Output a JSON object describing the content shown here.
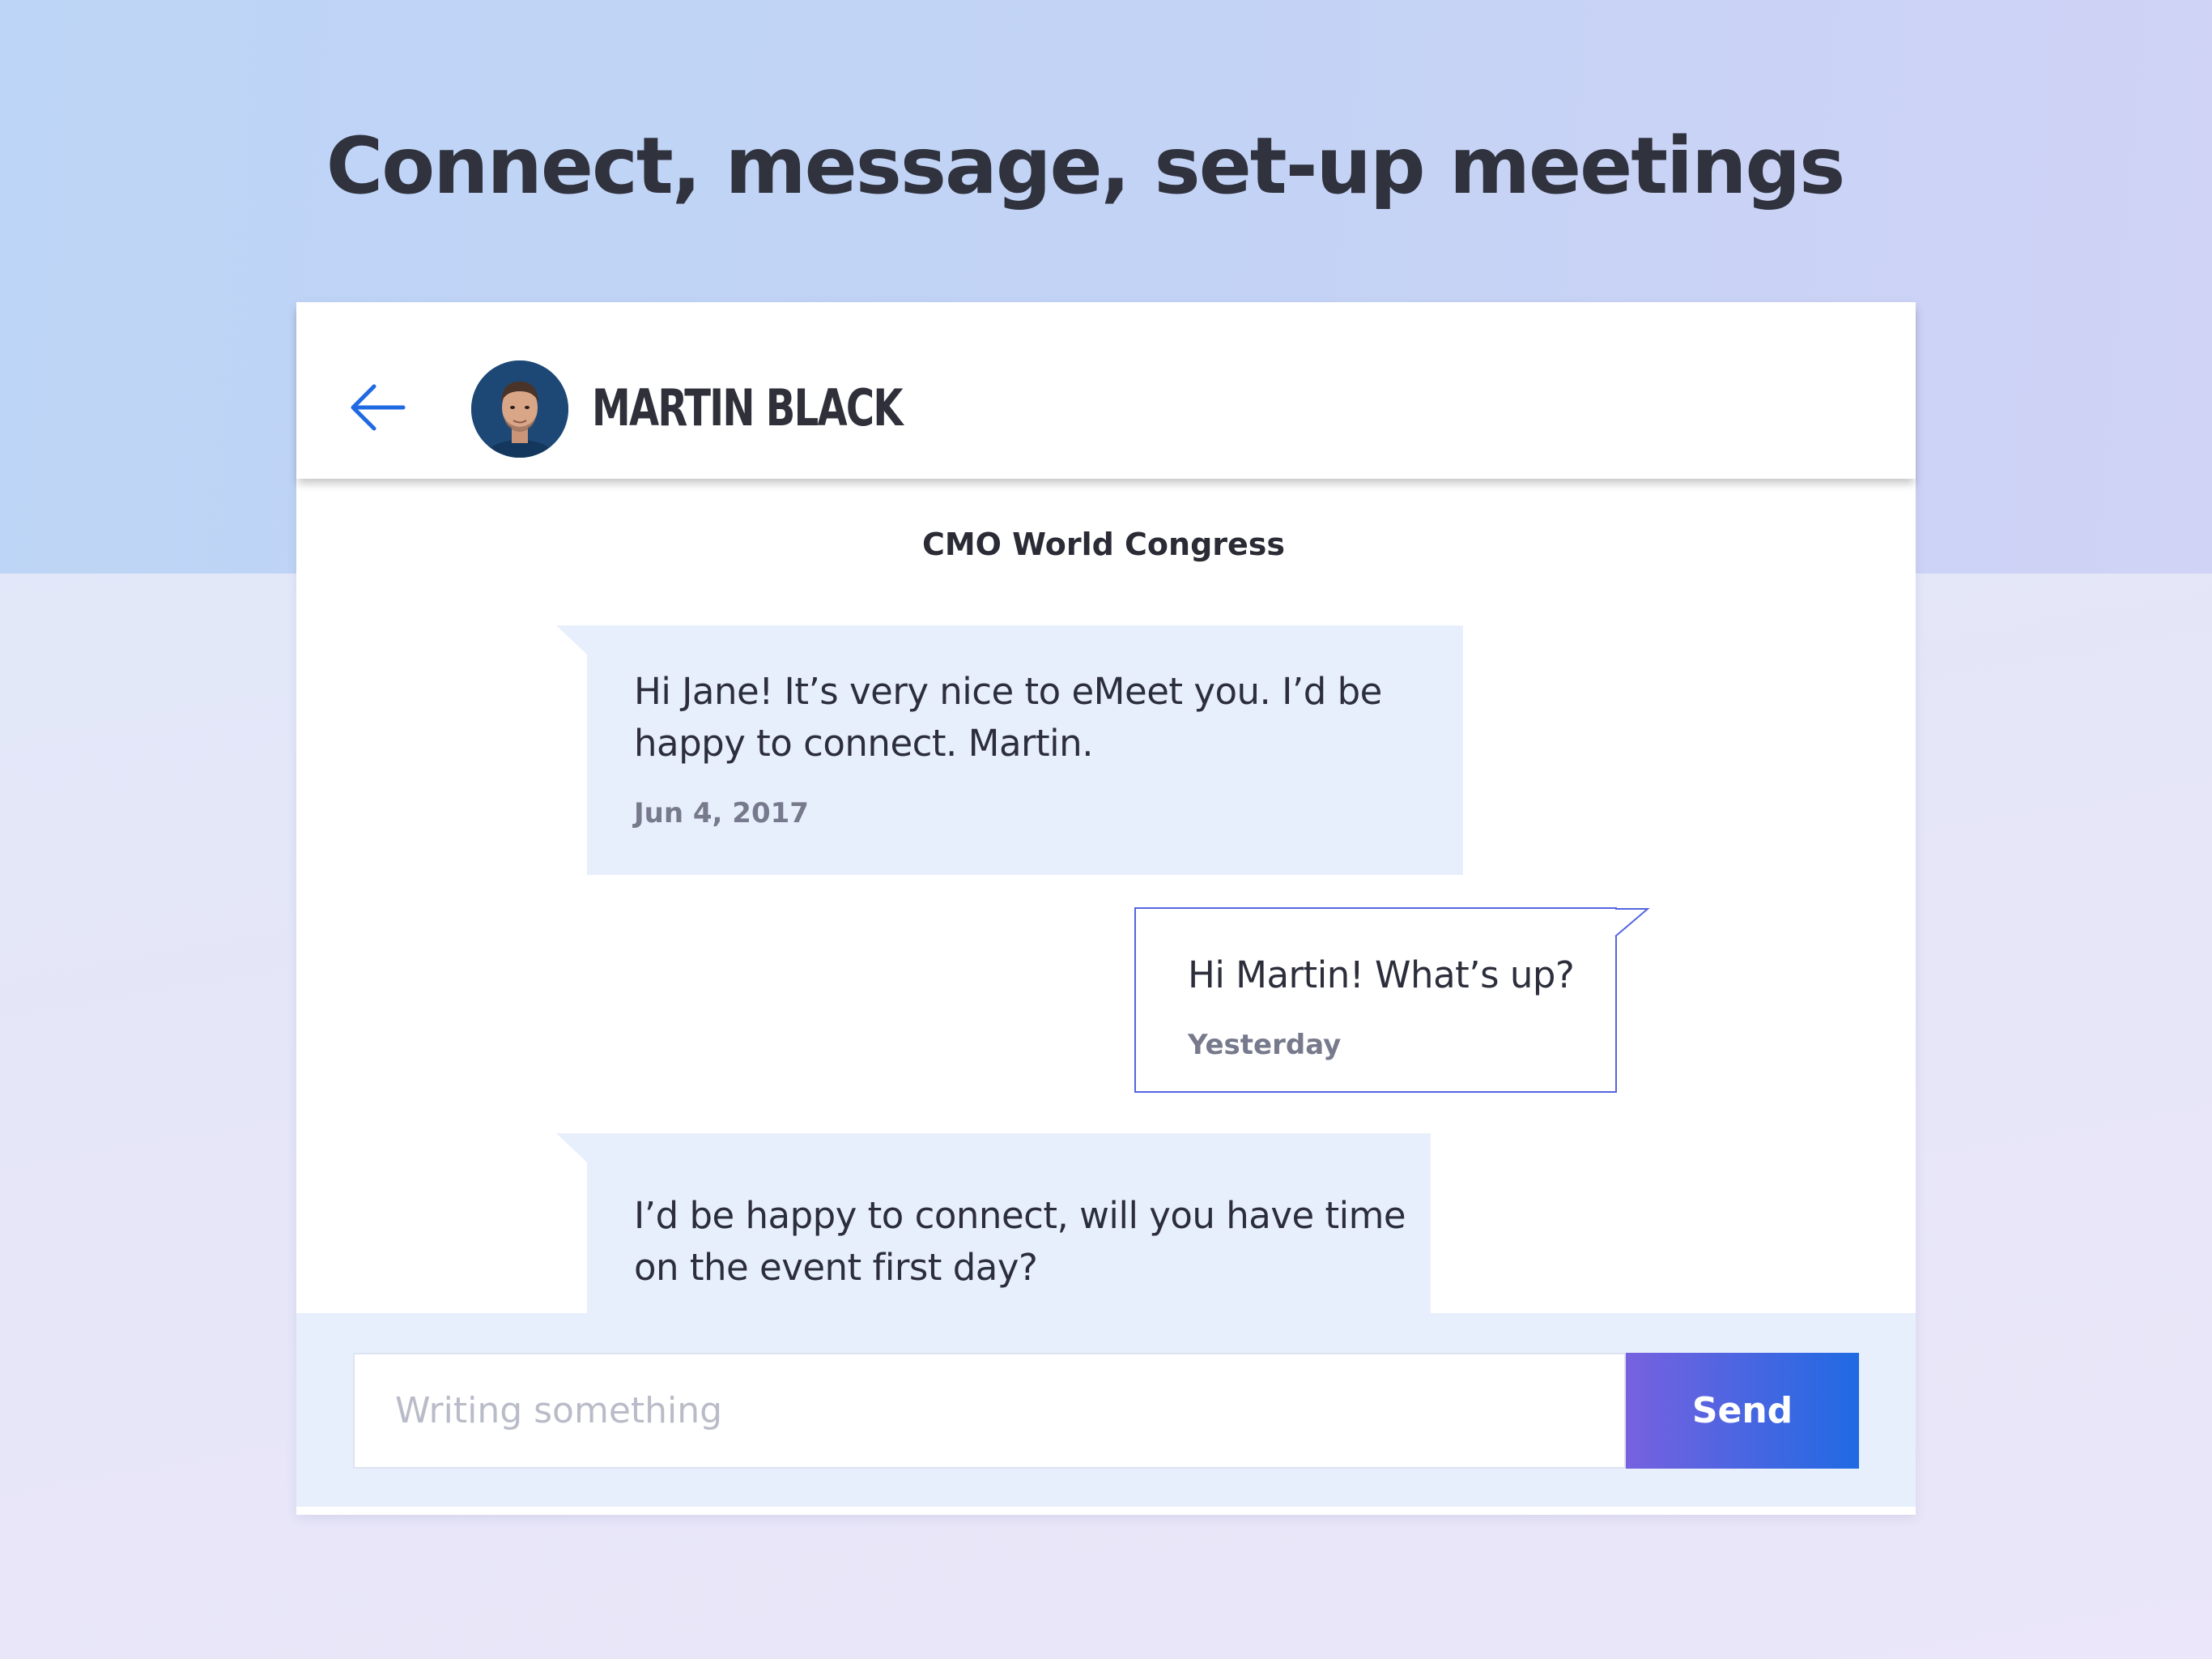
{
  "headline": "Connect, message, set-up meetings",
  "header": {
    "back_icon": "arrow-left-icon",
    "contact_name": "MARTIN BLACK"
  },
  "conversation": {
    "event_name": "CMO World Congress",
    "messages": [
      {
        "direction": "incoming",
        "text": "Hi Jane! It’s very nice to eMeet you. I’d be happy to connect. Martin.",
        "time": "Jun 4, 2017"
      },
      {
        "direction": "outgoing",
        "text": "Hi Martin! What’s up?",
        "time": "Yesterday"
      },
      {
        "direction": "incoming",
        "text": "I’d be happy to connect, will you have time on the event first day?"
      }
    ]
  },
  "composer": {
    "placeholder": "Writing something",
    "send_label": "Send"
  },
  "colors": {
    "accent_blue": "#1f6ae3",
    "accent_purple": "#7761df",
    "incoming_bubble": "#e8effc",
    "outgoing_border": "#5565e0",
    "hero_background": "#bdd5f6"
  }
}
